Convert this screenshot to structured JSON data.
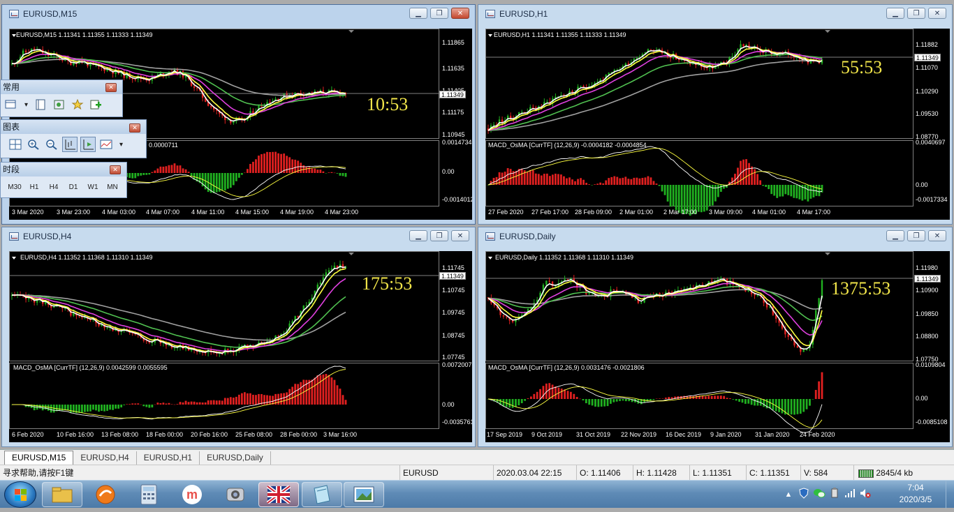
{
  "windows": {
    "m15": {
      "title": "EURUSD,M15",
      "info": "EURUSD,M15  1.11341 1.11355 1.11333 1.11349",
      "timer": "10:53",
      "current_price": "1.11349",
      "price_ticks": [
        "1.11865",
        "1.11635",
        "1.11405",
        "1.11175",
        "1.10945"
      ],
      "macd_label": "0.0000711",
      "macd_ticks": [
        "0.0014734",
        "0.00",
        "-0.0014012"
      ],
      "time_ticks": [
        "3 Mar 2020",
        "3 Mar 23:00",
        "4 Mar 03:00",
        "4 Mar 07:00",
        "4 Mar 11:00",
        "4 Mar 15:00",
        "4 Mar 19:00",
        "4 Mar 23:00"
      ]
    },
    "h1": {
      "title": "EURUSD,H1",
      "info": "EURUSD,H1  1.11341 1.11355 1.11333 1.11349",
      "timer": "55:53",
      "current_price": "1.11349",
      "price_ticks": [
        "1.11882",
        "1.11070",
        "1.10290",
        "1.09530",
        "1.08770"
      ],
      "macd_label": "MACD_OsMA [CurrTF] (12,26,9) -0.0004182 -0.0004854",
      "macd_ticks": [
        "0.0040697",
        "0.00",
        "-0.0017334"
      ],
      "time_ticks": [
        "27 Feb 2020",
        "27 Feb 17:00",
        "28 Feb 09:00",
        "2 Mar 01:00",
        "2 Mar 17:00",
        "3 Mar 09:00",
        "4 Mar 01:00",
        "4 Mar 17:00"
      ]
    },
    "h4": {
      "title": "EURUSD,H4",
      "info": "EURUSD,H4  1.11352 1.11368 1.11310 1.11349",
      "timer": "175:53",
      "current_price": "1.11349",
      "price_ticks": [
        "1.11745",
        "1.10745",
        "1.09745",
        "1.08745",
        "1.07745"
      ],
      "macd_label": "MACD_OsMA [CurrTF] (12,26,9) 0.0042599 0.0055595",
      "macd_ticks": [
        "0.0072007",
        "0.00",
        "-0.0035761"
      ],
      "time_ticks": [
        "6 Feb 2020",
        "10 Feb 16:00",
        "13 Feb 08:00",
        "18 Feb 00:00",
        "20 Feb 16:00",
        "25 Feb 08:00",
        "28 Feb 00:00",
        "3 Mar 16:00"
      ]
    },
    "daily": {
      "title": "EURUSD,Daily",
      "info": "EURUSD,Daily  1.11352 1.11368 1.11310 1.11349",
      "timer": "1375:53",
      "current_price": "1.11349",
      "price_ticks": [
        "1.11980",
        "1.10900",
        "1.09850",
        "1.08800",
        "1.07750"
      ],
      "macd_label": "MACD_OsMA [CurrTF] (12,26,9) 0.0031476 -0.0021806",
      "macd_ticks": [
        "0.0109804",
        "0.00",
        "-0.0085108"
      ],
      "time_ticks": [
        "17 Sep 2019",
        "9 Oct 2019",
        "31 Oct 2019",
        "22 Nov 2019",
        "16 Dec 2019",
        "9 Jan 2020",
        "31 Jan 2020",
        "24 Feb 2020"
      ]
    }
  },
  "toolbars": {
    "common": {
      "title": "常用"
    },
    "charts": {
      "title": "图表"
    },
    "periods": {
      "title": "时段",
      "buttons": [
        "M30",
        "H1",
        "H4",
        "D1",
        "W1",
        "MN"
      ]
    }
  },
  "tabs": [
    "EURUSD,M15",
    "EURUSD,H4",
    "EURUSD,H1",
    "EURUSD,Daily"
  ],
  "status": {
    "help": "寻求帮助,请按F1键",
    "symbol": "EURUSD",
    "datetime": "2020.03.04 22:15",
    "open": "O: 1.11406",
    "high": "H: 1.11428",
    "low": "L: 1.11351",
    "close": "C: 1.11351",
    "volume": "V: 584",
    "traffic": "2845/4 kb"
  },
  "clock": {
    "time": "7:04",
    "date": "2020/3/5"
  },
  "colors": {
    "bull": "#20b020",
    "bear": "#e02020",
    "timer": "#f2e64a",
    "ma_white": "#ffffff",
    "ma_yellow": "#ffff40",
    "ma_magenta": "#e040e0",
    "ma_green": "#50c050",
    "ma_gray": "#a0a0a0"
  }
}
